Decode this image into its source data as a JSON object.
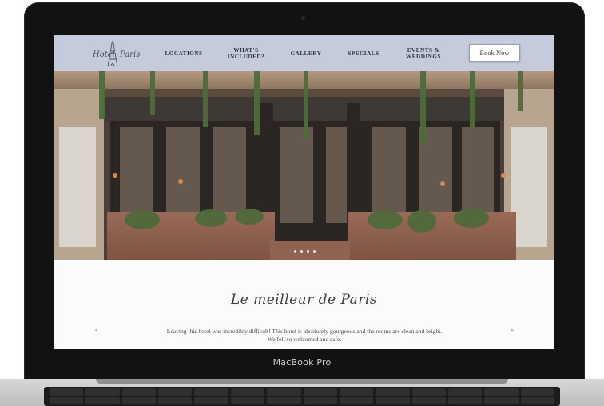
{
  "device": {
    "brand_label": "MacBook Pro"
  },
  "nav": {
    "logo_word1": "Hotel",
    "logo_word2": "Paris",
    "items": [
      {
        "label": "LOCATIONS"
      },
      {
        "label": "WHAT'S\nINCLUDED?"
      },
      {
        "label": "GALLERY"
      },
      {
        "label": "SPECIALS"
      },
      {
        "label": "EVENTS &\nWEDDINGS"
      }
    ],
    "book_label": "Book Now"
  },
  "hero": {
    "slide_count": 4,
    "active_slide": 1
  },
  "content": {
    "tagline": "Le meilleur de Paris",
    "testimonial": "Leaving this hotel was incredibly difficult! This hotel is absolutely gourgeous and the rooms are clean and bright. We felt so welcomed and safe.",
    "prev_arrow": "◂",
    "next_arrow": "▸"
  },
  "colors": {
    "nav_bg": "#c6cbdc",
    "nav_text": "#2f3346",
    "page_bg": "#fbfbfb"
  }
}
